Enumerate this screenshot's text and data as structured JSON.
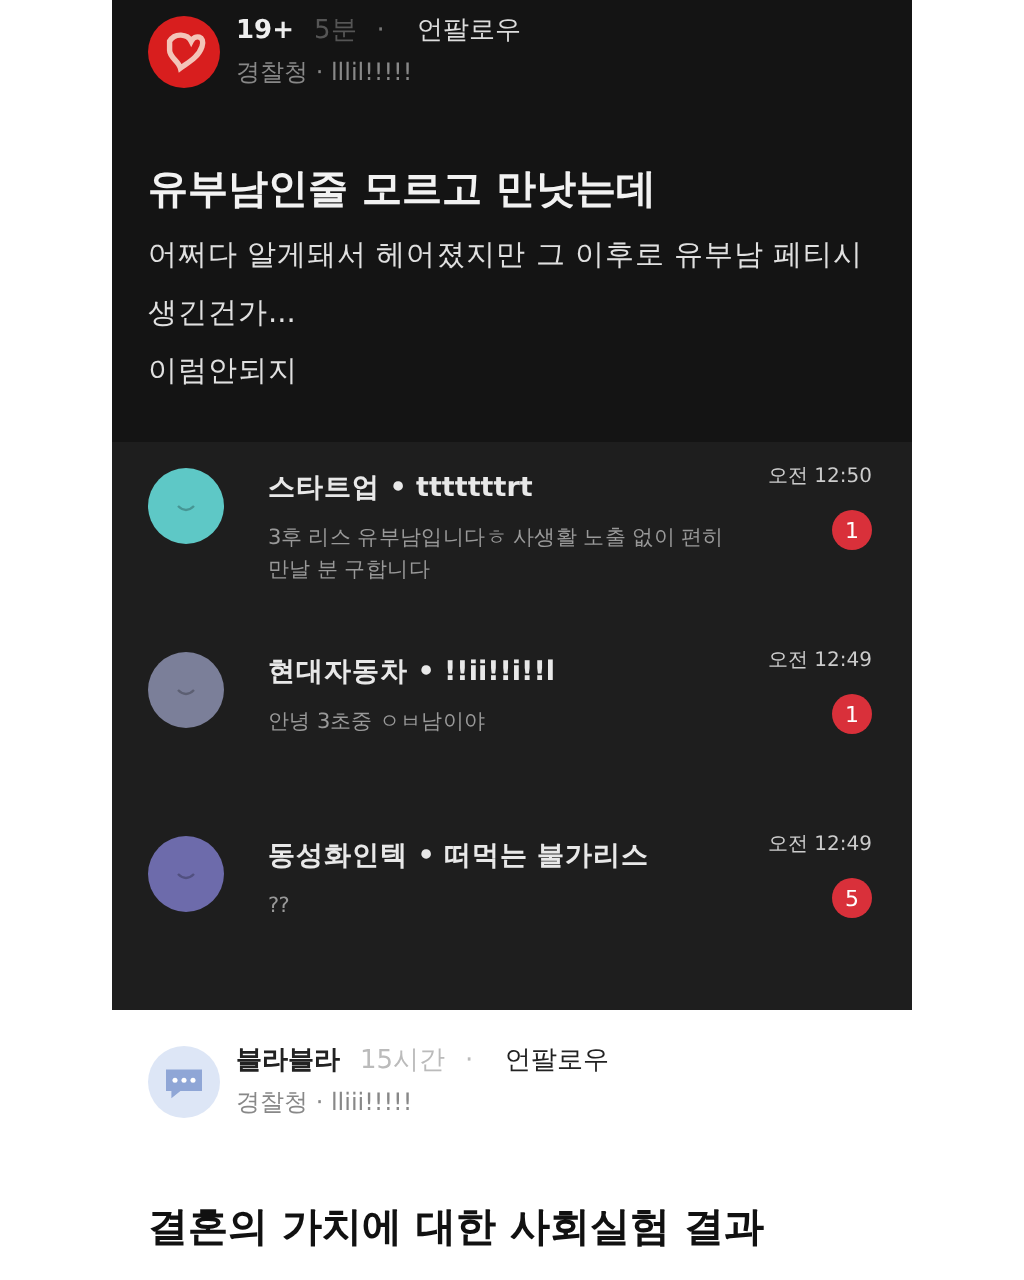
{
  "post": {
    "author": "19+",
    "time": "5분",
    "separator": "·",
    "follow": "언팔로우",
    "affiliation": "경찰청 · lllil!!!!!",
    "title": "유부남인줄 모르고 만낫는데",
    "body": [
      "어쩌다 알게돼서 헤어졌지만 그 이후로 유부남 페티시",
      "생긴건가...",
      "이럼안되지"
    ]
  },
  "messages": [
    {
      "sender": "스타트업 • tttttttrt",
      "time": "오전 12:50",
      "text": "3후 리스 유부남입니다ㅎ 사생활 노출 없이 편히 만날 분 구합니다",
      "unread": "1",
      "color": "#5ec8c6"
    },
    {
      "sender": "현대자동차 • !!ii!!i!!l",
      "time": "오전 12:49",
      "text": "안녕 3초중 ㅇㅂ남이야",
      "unread": "1",
      "color": "#7b7f99"
    },
    {
      "sender": "동성화인텍 • 떠먹는 불가리스",
      "time": "오전 12:49",
      "text": "??",
      "unread": "5",
      "color": "#6d6bab"
    }
  ],
  "next_post": {
    "author": "블라블라",
    "time": "15시간",
    "separator": "·",
    "follow": "언팔로우",
    "affiliation": "경찰청 · lliii!!!!!",
    "title": "결혼의 가치에 대한 사회실험 결과"
  }
}
